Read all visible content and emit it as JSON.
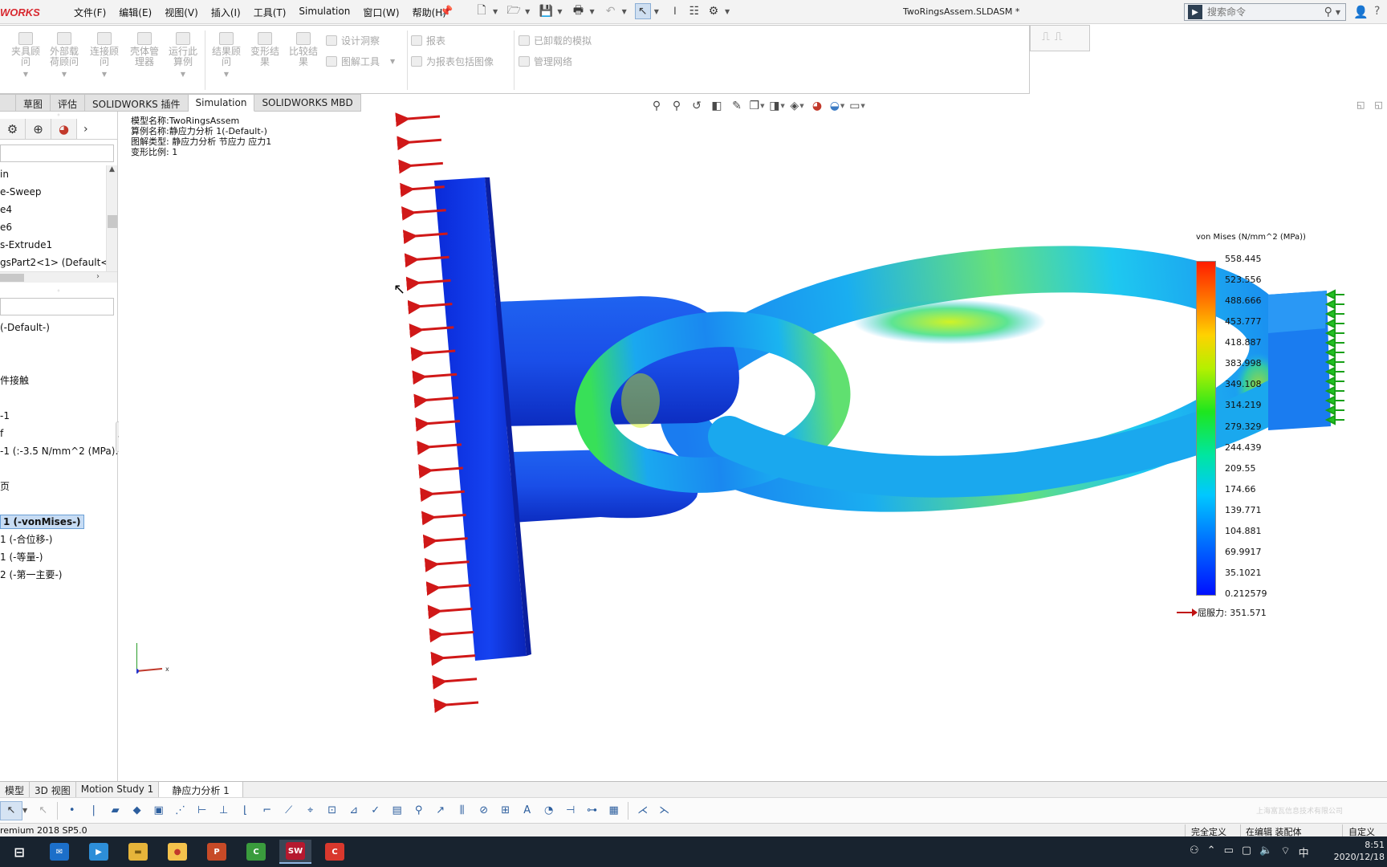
{
  "app": {
    "brand": "WORKS",
    "document_title": "TwoRingsAssem.SLDASM *",
    "menu": [
      "文件(F)",
      "编辑(E)",
      "视图(V)",
      "插入(I)",
      "工具(T)",
      "Simulation",
      "窗口(W)",
      "帮助(H)"
    ],
    "search_placeholder": "搜索命令"
  },
  "command_manager": {
    "big_buttons": [
      {
        "label": "夹具顾\n问"
      },
      {
        "label": "外部载\n荷顾问"
      },
      {
        "label": "连接顾\n问"
      },
      {
        "label": "壳体管\n理器"
      },
      {
        "label": "运行此\n算例"
      },
      {
        "label": "结果顾\n问"
      },
      {
        "label": "变形结\n果"
      },
      {
        "label": "比较结\n果"
      }
    ],
    "small_buttons": [
      {
        "label": "设计洞察"
      },
      {
        "label": "图解工具"
      },
      {
        "label": "报表"
      },
      {
        "label": "为报表包括图像"
      },
      {
        "label": "已卸载的模拟"
      },
      {
        "label": "管理网络"
      }
    ],
    "tabs": [
      "草图",
      "评估",
      "SOLIDWORKS 插件",
      "Simulation",
      "SOLIDWORKS MBD"
    ],
    "active_tab": "Simulation"
  },
  "feature_tree": {
    "items": [
      "in",
      "e-Sweep",
      "e4",
      "e6",
      "s-Extrude1",
      "gsPart2<1> (Default<<"
    ]
  },
  "study_tree": {
    "items": [
      {
        "label": " (-Default-)",
        "selected": false
      },
      {
        "label": "",
        "selected": false
      },
      {
        "label": "",
        "selected": false
      },
      {
        "label": "件接触",
        "selected": false
      },
      {
        "label": "",
        "selected": false
      },
      {
        "label": "-1",
        "selected": false
      },
      {
        "label": "f",
        "selected": false
      },
      {
        "label": "-1 (:-3.5 N/mm^2 (MPa):)",
        "selected": false
      },
      {
        "label": "",
        "selected": false
      },
      {
        "label": "页",
        "selected": false
      },
      {
        "label": "",
        "selected": false
      },
      {
        "label": "1 (-vonMises-)",
        "selected": true
      },
      {
        "label": "1 (-合位移-)",
        "selected": false
      },
      {
        "label": "1 (-等量-)",
        "selected": false
      },
      {
        "label": "2 (-第一主要-)",
        "selected": false
      }
    ]
  },
  "plot_info": {
    "model_name": "模型名称:TwoRingsAssem",
    "study_name": "算例名称:静应力分析 1(-Default-)",
    "plot_type": "图解类型: 静应力分析 节应力 应力1",
    "deformation_scale": "变形比例: 1"
  },
  "legend": {
    "title": "von Mises (N/mm^2 (MPa))",
    "values": [
      "558.445",
      "523.556",
      "488.666",
      "453.777",
      "418.887",
      "383.998",
      "349.108",
      "314.219",
      "279.329",
      "244.439",
      "209.55",
      "174.66",
      "139.771",
      "104.881",
      "69.9917",
      "35.1021",
      "0.212579"
    ],
    "yield_label": "屈服力: 351.571",
    "colors": {
      "max": "#ff1d00",
      "mid": "#1ee61e",
      "min": "#0010ff"
    }
  },
  "triad": {
    "x": "x",
    "y": "y",
    "z": "z"
  },
  "bottom_tabs": [
    "模型",
    "3D 视图",
    "Motion Study 1",
    "静应力分析 1"
  ],
  "active_bottom_tab": "静应力分析 1",
  "watermark": "上海富瓦信息技术有限公司",
  "status": {
    "left": "remium 2018 SP5.0",
    "r1": "完全定义",
    "r2": "在编辑 装配体",
    "r3": "自定义"
  },
  "taskbar": {
    "apps": [
      {
        "name": "task-view",
        "color": "#18232f",
        "text": "⊟"
      },
      {
        "name": "mail",
        "color": "#1c6fc9",
        "text": "✉"
      },
      {
        "name": "video",
        "color": "#2d8ed8",
        "text": "▶"
      },
      {
        "name": "explorer",
        "color": "#e6b43a",
        "text": "▬"
      },
      {
        "name": "paint",
        "color": "#f4c24c",
        "text": "●"
      },
      {
        "name": "powerpoint",
        "color": "#c74a27",
        "text": "P"
      },
      {
        "name": "camtasia-green",
        "color": "#3a9c3d",
        "text": "C"
      },
      {
        "name": "solidworks",
        "color": "#b5192f",
        "text": "SW"
      },
      {
        "name": "camtasia-red",
        "color": "#d9382d",
        "text": "C"
      }
    ],
    "time": "8:51",
    "date": "2020/12/18",
    "ime": "中"
  }
}
